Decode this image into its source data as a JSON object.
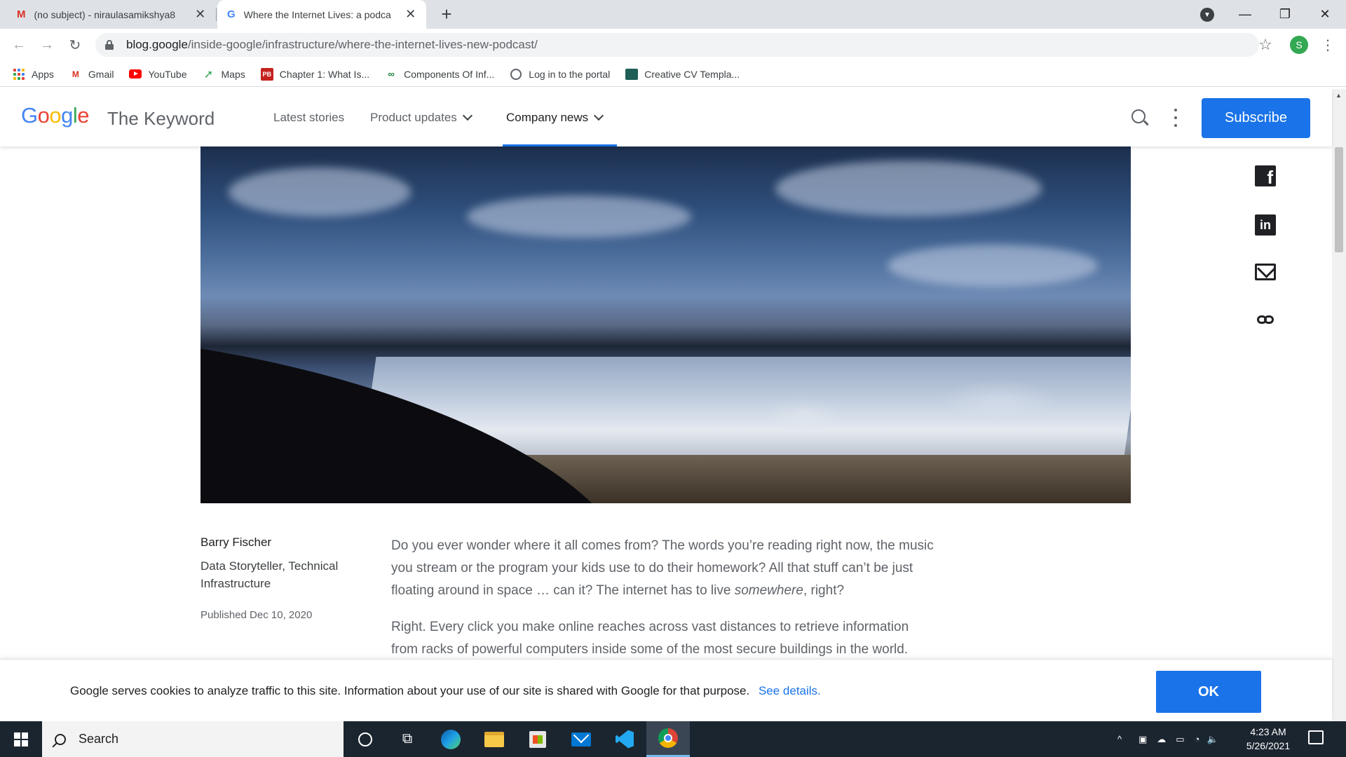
{
  "browser": {
    "tabs": [
      {
        "title": "(no subject) - niraulasamikshya8",
        "active": false
      },
      {
        "title": "Where the Internet Lives: a podca",
        "active": true
      }
    ],
    "new_tab_symbol": "+",
    "close_symbol": "✕",
    "url_domain": "blog.google",
    "url_path": "/inside-google/infrastructure/where-the-internet-lives-new-podcast/",
    "profile_initial": "S",
    "window_controls": {
      "minimize": "—",
      "restore": "❐",
      "close": "✕"
    }
  },
  "bookmarks": [
    {
      "label": "Apps",
      "icon": "apps-grid-icon"
    },
    {
      "label": "Gmail",
      "icon": "gmail-icon"
    },
    {
      "label": "YouTube",
      "icon": "youtube-icon"
    },
    {
      "label": "Maps",
      "icon": "maps-icon"
    },
    {
      "label": "Chapter 1: What Is...",
      "icon": "pb-icon"
    },
    {
      "label": "Components Of Inf...",
      "icon": "components-icon"
    },
    {
      "label": "Log in to the portal",
      "icon": "globe-icon"
    },
    {
      "label": "Creative CV Templa...",
      "icon": "cv-icon"
    }
  ],
  "site": {
    "logo": "Google",
    "name": "The Keyword",
    "nav": [
      {
        "label": "Latest stories",
        "dropdown": false
      },
      {
        "label": "Product updates",
        "dropdown": true
      },
      {
        "label": "Company news",
        "dropdown": true,
        "current": true
      }
    ],
    "subscribe_label": "Subscribe",
    "accent_color": "#1a73e8"
  },
  "article": {
    "author_name": "Barry Fischer",
    "author_title": "Data Storyteller, Technical Infrastructure",
    "published": "Published Dec 10, 2020",
    "p1_part1": "Do you ever wonder where it all comes from? The words you’re reading right now, the music you stream or the program your kids use to do their homework? All that stuff can’t be just floating around in space … can it? The internet has to live ",
    "p1_em": "somewhere",
    "p1_part2": ", right?",
    "p2": "Right. Every click you make online reaches across vast distances to retrieve information from racks of powerful computers inside some of the most secure buildings in the world."
  },
  "share_icons": [
    "facebook-icon",
    "linkedin-icon",
    "mail-icon",
    "link-icon"
  ],
  "cookie": {
    "text": "Google serves cookies to analyze traffic to this site. Information about your use of our site is shared with Google for that purpose.",
    "link": "See details.",
    "ok": "OK"
  },
  "taskbar": {
    "search_placeholder": "Search",
    "time": "4:23 AM",
    "date": "5/26/2021"
  }
}
